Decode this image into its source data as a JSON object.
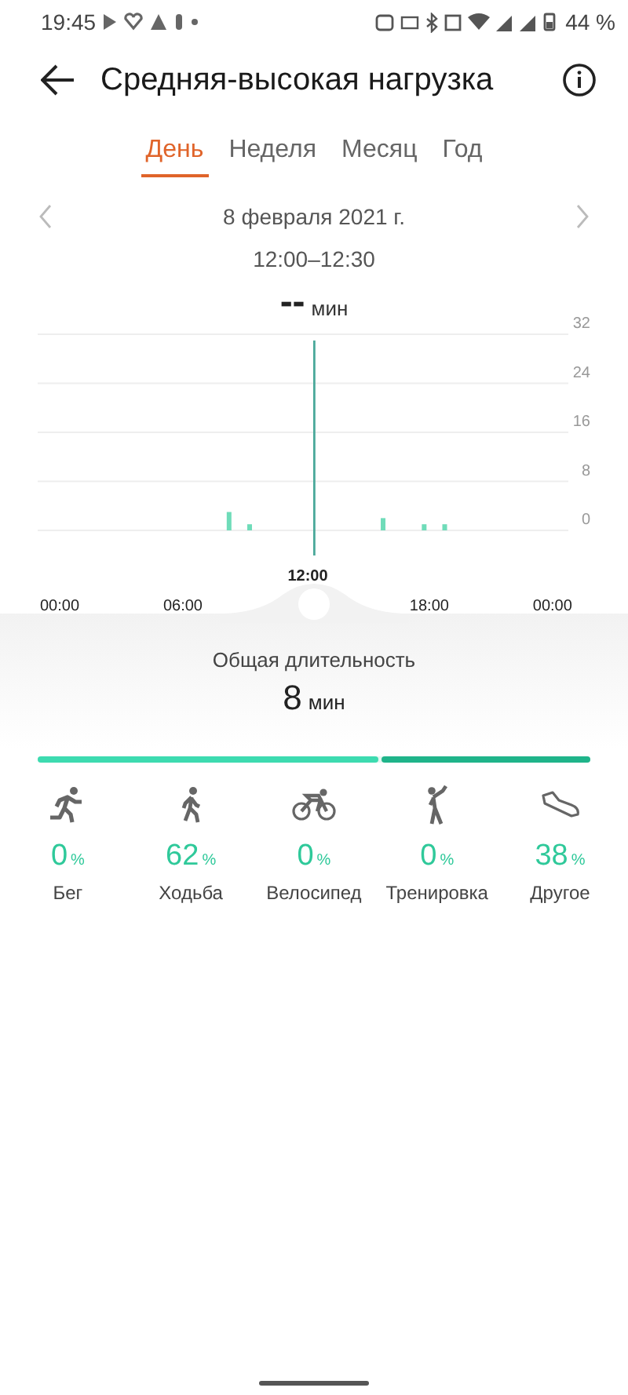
{
  "status_bar": {
    "time": "19:45",
    "battery": "44 %"
  },
  "header": {
    "title": "Средняя-высокая нагрузка"
  },
  "tabs": [
    {
      "label": "День",
      "selected": true
    },
    {
      "label": "Неделя",
      "selected": false
    },
    {
      "label": "Месяц",
      "selected": false
    },
    {
      "label": "Год",
      "selected": false
    }
  ],
  "date": "8 февраля 2021 г.",
  "time_range": "12:00–12:30",
  "reading": {
    "value": "--",
    "unit": "мин"
  },
  "chart": {
    "cursor_label": "12:00",
    "chart_data": {
      "type": "bar",
      "x": [
        8.25,
        9.25,
        15.75,
        17.75,
        18.75
      ],
      "values": [
        3,
        1,
        2,
        1,
        1
      ],
      "xlim": [
        0,
        24
      ],
      "ylim": [
        0,
        32
      ],
      "xticks": [
        {
          "value": 0,
          "label": "00:00"
        },
        {
          "value": 6,
          "label": "06:00"
        },
        {
          "value": 18,
          "label": "18:00"
        },
        {
          "value": 24,
          "label": "00:00"
        }
      ],
      "yticks": [
        0,
        8,
        16,
        24,
        32
      ],
      "grid": true,
      "ref_lines": [
        {
          "axis": "x",
          "value": 12.4,
          "color": "#4aa89a"
        }
      ]
    }
  },
  "summary": {
    "label": "Общая длительность",
    "value": "8",
    "unit": "мин"
  },
  "breakdown": [
    {
      "level": 0.62,
      "color": "#3ddbb0"
    },
    {
      "level": 0.38,
      "color": "#1fb48a"
    }
  ],
  "activities": [
    {
      "kind": "run",
      "percent": "0",
      "unit": "%",
      "label": "Бег"
    },
    {
      "kind": "walk",
      "percent": "62",
      "unit": "%",
      "label": "Ходьба"
    },
    {
      "kind": "bike",
      "percent": "0",
      "unit": "%",
      "label": "Велосипед"
    },
    {
      "kind": "workout",
      "percent": "0",
      "unit": "%",
      "label": "Тренировка"
    },
    {
      "kind": "shoe",
      "percent": "38",
      "unit": "%",
      "label": "Другое"
    }
  ]
}
